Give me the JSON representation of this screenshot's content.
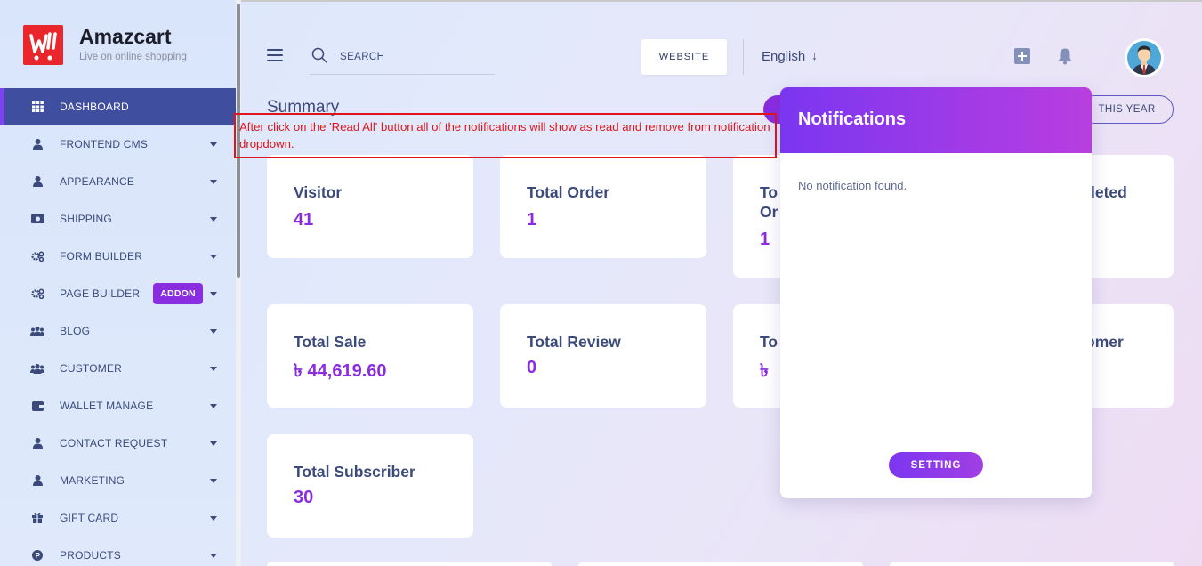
{
  "brand": {
    "name": "Amazcart",
    "tagline": "Live on online shopping"
  },
  "sidebar": {
    "items": [
      {
        "label": "DASHBOARD",
        "icon": "grid-icon",
        "active": true,
        "caret": false
      },
      {
        "label": "FRONTEND CMS",
        "icon": "user-icon",
        "caret": true
      },
      {
        "label": "APPEARANCE",
        "icon": "user-icon",
        "caret": true
      },
      {
        "label": "SHIPPING",
        "icon": "money-icon",
        "caret": true
      },
      {
        "label": "FORM BUILDER",
        "icon": "gears-icon",
        "caret": true
      },
      {
        "label": "PAGE BUILDER",
        "icon": "gears-icon",
        "caret": true,
        "badge": "ADDON"
      },
      {
        "label": "BLOG",
        "icon": "users-icon",
        "caret": true
      },
      {
        "label": "CUSTOMER",
        "icon": "users-icon",
        "caret": true
      },
      {
        "label": "WALLET MANAGE",
        "icon": "wallet-icon",
        "caret": true
      },
      {
        "label": "CONTACT REQUEST",
        "icon": "user-icon",
        "caret": true
      },
      {
        "label": "MARKETING",
        "icon": "user-icon",
        "caret": true
      },
      {
        "label": "GIFT CARD",
        "icon": "gift-icon",
        "caret": true
      },
      {
        "label": "PRODUCTS",
        "icon": "product-icon",
        "caret": true
      }
    ]
  },
  "header": {
    "search_placeholder": "SEARCH",
    "website_label": "WEBSITE",
    "language": "English",
    "language_arrow": "↓"
  },
  "summary": {
    "title": "Summary",
    "period_label": "THIS YEAR",
    "cards": [
      {
        "title": "Visitor",
        "value": "41"
      },
      {
        "title": "Total Order",
        "value": "1"
      },
      {
        "title_a": "To",
        "title_b": "Or",
        "value": "1"
      },
      {
        "title": "leted"
      },
      {
        "title": "Total Sale",
        "value": "৳ 44,619.60"
      },
      {
        "title": "Total Review",
        "value": "0"
      },
      {
        "title": "To",
        "value": "৳"
      },
      {
        "title": "omer"
      },
      {
        "title": "Total Subscriber",
        "value": "30"
      }
    ]
  },
  "annotation": {
    "text": "After click on the 'Read All' button all of the notifications will show as read and remove from notification dropdown.",
    "color": "#e0141b"
  },
  "notifications": {
    "title": "Notifications",
    "empty_text": "No notification found.",
    "setting_label": "SETTING"
  },
  "colors": {
    "accent": "#8a2ce0",
    "active_nav": "#3f4e9e",
    "text": "#3b4a7a"
  }
}
